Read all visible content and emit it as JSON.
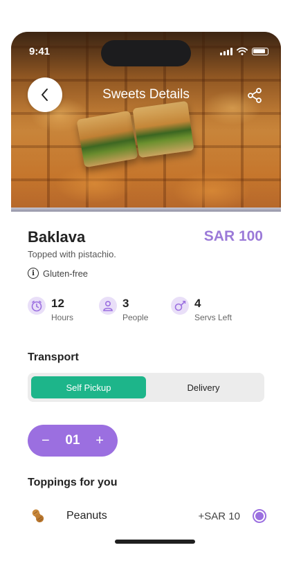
{
  "status": {
    "time": "9:41"
  },
  "header": {
    "title": "Sweets Details"
  },
  "product": {
    "name": "Baklava",
    "price": "SAR 100",
    "description": "Topped with pistachio.",
    "tag": "Gluten-free"
  },
  "stats": [
    {
      "value": "12",
      "label": "Hours",
      "icon": "clock-icon"
    },
    {
      "value": "3",
      "label": "People",
      "icon": "person-icon"
    },
    {
      "value": "4",
      "label": "Servs Left",
      "icon": "chef-icon"
    }
  ],
  "transport": {
    "title": "Transport",
    "options": [
      "Self Pickup",
      "Delivery"
    ],
    "selected": "Self Pickup"
  },
  "quantity": {
    "minus": "−",
    "value": "01",
    "plus": "+"
  },
  "toppings": {
    "title": "Toppings for you",
    "items": [
      {
        "name": "Peanuts",
        "price": "+SAR 10",
        "selected": true
      }
    ]
  },
  "colors": {
    "accent": "#9b6fe0",
    "price": "#9b7ad8",
    "selected_tab": "#1db58a"
  }
}
